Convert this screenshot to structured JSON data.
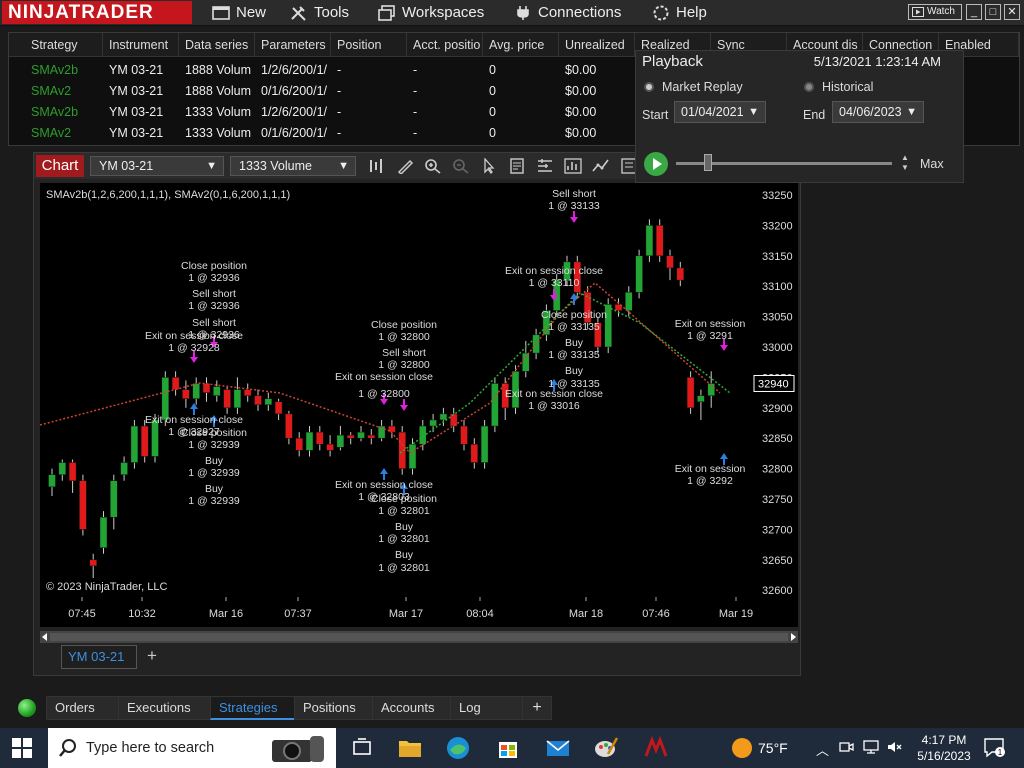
{
  "app": {
    "logo": "NINJATRADER",
    "menu": [
      {
        "label": "New",
        "icon": "new-window-icon"
      },
      {
        "label": "Tools",
        "icon": "tools-icon"
      },
      {
        "label": "Workspaces",
        "icon": "workspaces-icon"
      },
      {
        "label": "Connections",
        "icon": "connections-plug-icon"
      },
      {
        "label": "Help",
        "icon": "help-icon"
      }
    ],
    "watch_label": "Watch"
  },
  "strategies_grid": {
    "columns": [
      "Strategy",
      "Instrument",
      "Data series",
      "Parameters",
      "Position",
      "Acct. positio",
      "Avg. price",
      "Unrealized",
      "Realized",
      "Sync",
      "Account dis",
      "Connection",
      "Enabled"
    ],
    "rows": [
      [
        "SMAv2b",
        "YM 03-21",
        "1888 Volum",
        "1/2/6/200/1/",
        "-",
        "-",
        "0",
        "$0.00"
      ],
      [
        "SMAv2",
        "YM 03-21",
        "1888 Volum",
        "0/1/6/200/1/",
        "-",
        "-",
        "0",
        "$0.00"
      ],
      [
        "SMAv2b",
        "YM 03-21",
        "1333 Volum",
        "1/2/6/200/1/",
        "-",
        "-",
        "0",
        "$0.00"
      ],
      [
        "SMAv2",
        "YM 03-21",
        "1333 Volum",
        "0/1/6/200/1/",
        "-",
        "-",
        "0",
        "$0.00"
      ]
    ]
  },
  "playback": {
    "title": "Playback",
    "current_time": "5/13/2021 1:23:14 AM",
    "market_replay_label": "Market Replay",
    "historical_label": "Historical",
    "start_label": "Start",
    "start_date": "01/04/2021",
    "end_label": "End",
    "end_date": "04/06/2023",
    "speed_label": "Max",
    "slider_position": 0.15
  },
  "chart": {
    "window_label": "Chart",
    "instrument": "YM 03-21",
    "interval": "1333 Volume",
    "indicator_label": "SMAv2b(1,2,6,200,1,1,1), SMAv2(0,1,6,200,1,1,1)",
    "copyright": "© 2023 NinjaTrader, LLC",
    "tab_label": "YM 03-21",
    "price_marker": "32940",
    "y_ticks": [
      "33250",
      "33200",
      "33150",
      "33100",
      "33050",
      "33000",
      "32950",
      "32900",
      "32850",
      "32800",
      "32750",
      "32700",
      "32650",
      "32600"
    ],
    "x_ticks": [
      "07:45",
      "10:32",
      "Mar 16",
      "07:37",
      "Mar 17",
      "08:04",
      "Mar 18",
      "07:46",
      "Mar 19"
    ],
    "annotations": [
      "Close position",
      "1 @ 32936",
      "Sell short",
      "1 @ 32936",
      "Sell short",
      "1 @ 32936",
      "Exit on session close",
      "1 @ 32928",
      "Exit on session close",
      "1 @ 32927",
      "Close position",
      "1 @ 32939",
      "Buy",
      "1 @ 32939",
      "Buy",
      "1 @ 32939",
      "Close position",
      "1 @ 32800",
      "Sell short",
      "1 @ 32800",
      "Exit on session close",
      "1 @ 32800",
      "Exit on session close",
      "1 @ 32803",
      "Close position",
      "1 @ 32801",
      "Buy",
      "1 @ 32801",
      "Buy",
      "1 @ 32801",
      "Sell short",
      "1 @ 33133",
      "Exit on session close",
      "1 @ 33110",
      "Close position",
      "1 @ 33135",
      "Buy",
      "1 @ 33135",
      "Buy",
      "1 @ 33135",
      "Exit on session close",
      "1 @ 33016",
      "Exit on session",
      "1 @ 3291",
      "Exit on session",
      "1 @ 3292"
    ]
  },
  "bottom_tabs": [
    "Orders",
    "Executions",
    "Strategies",
    "Positions",
    "Accounts",
    "Log"
  ],
  "taskbar": {
    "search_placeholder": "Type here to search",
    "temperature": "75°F",
    "time": "4:17 PM",
    "date": "5/16/2023",
    "notification_count": "1"
  },
  "colors": {
    "brand_red": "#c4161c",
    "up_candle": "#22a534",
    "down_candle": "#e01a1a",
    "buy_arrow": "#2a7fe0",
    "sell_arrow": "#e020e0",
    "active_tab": "#3d8fe0"
  }
}
